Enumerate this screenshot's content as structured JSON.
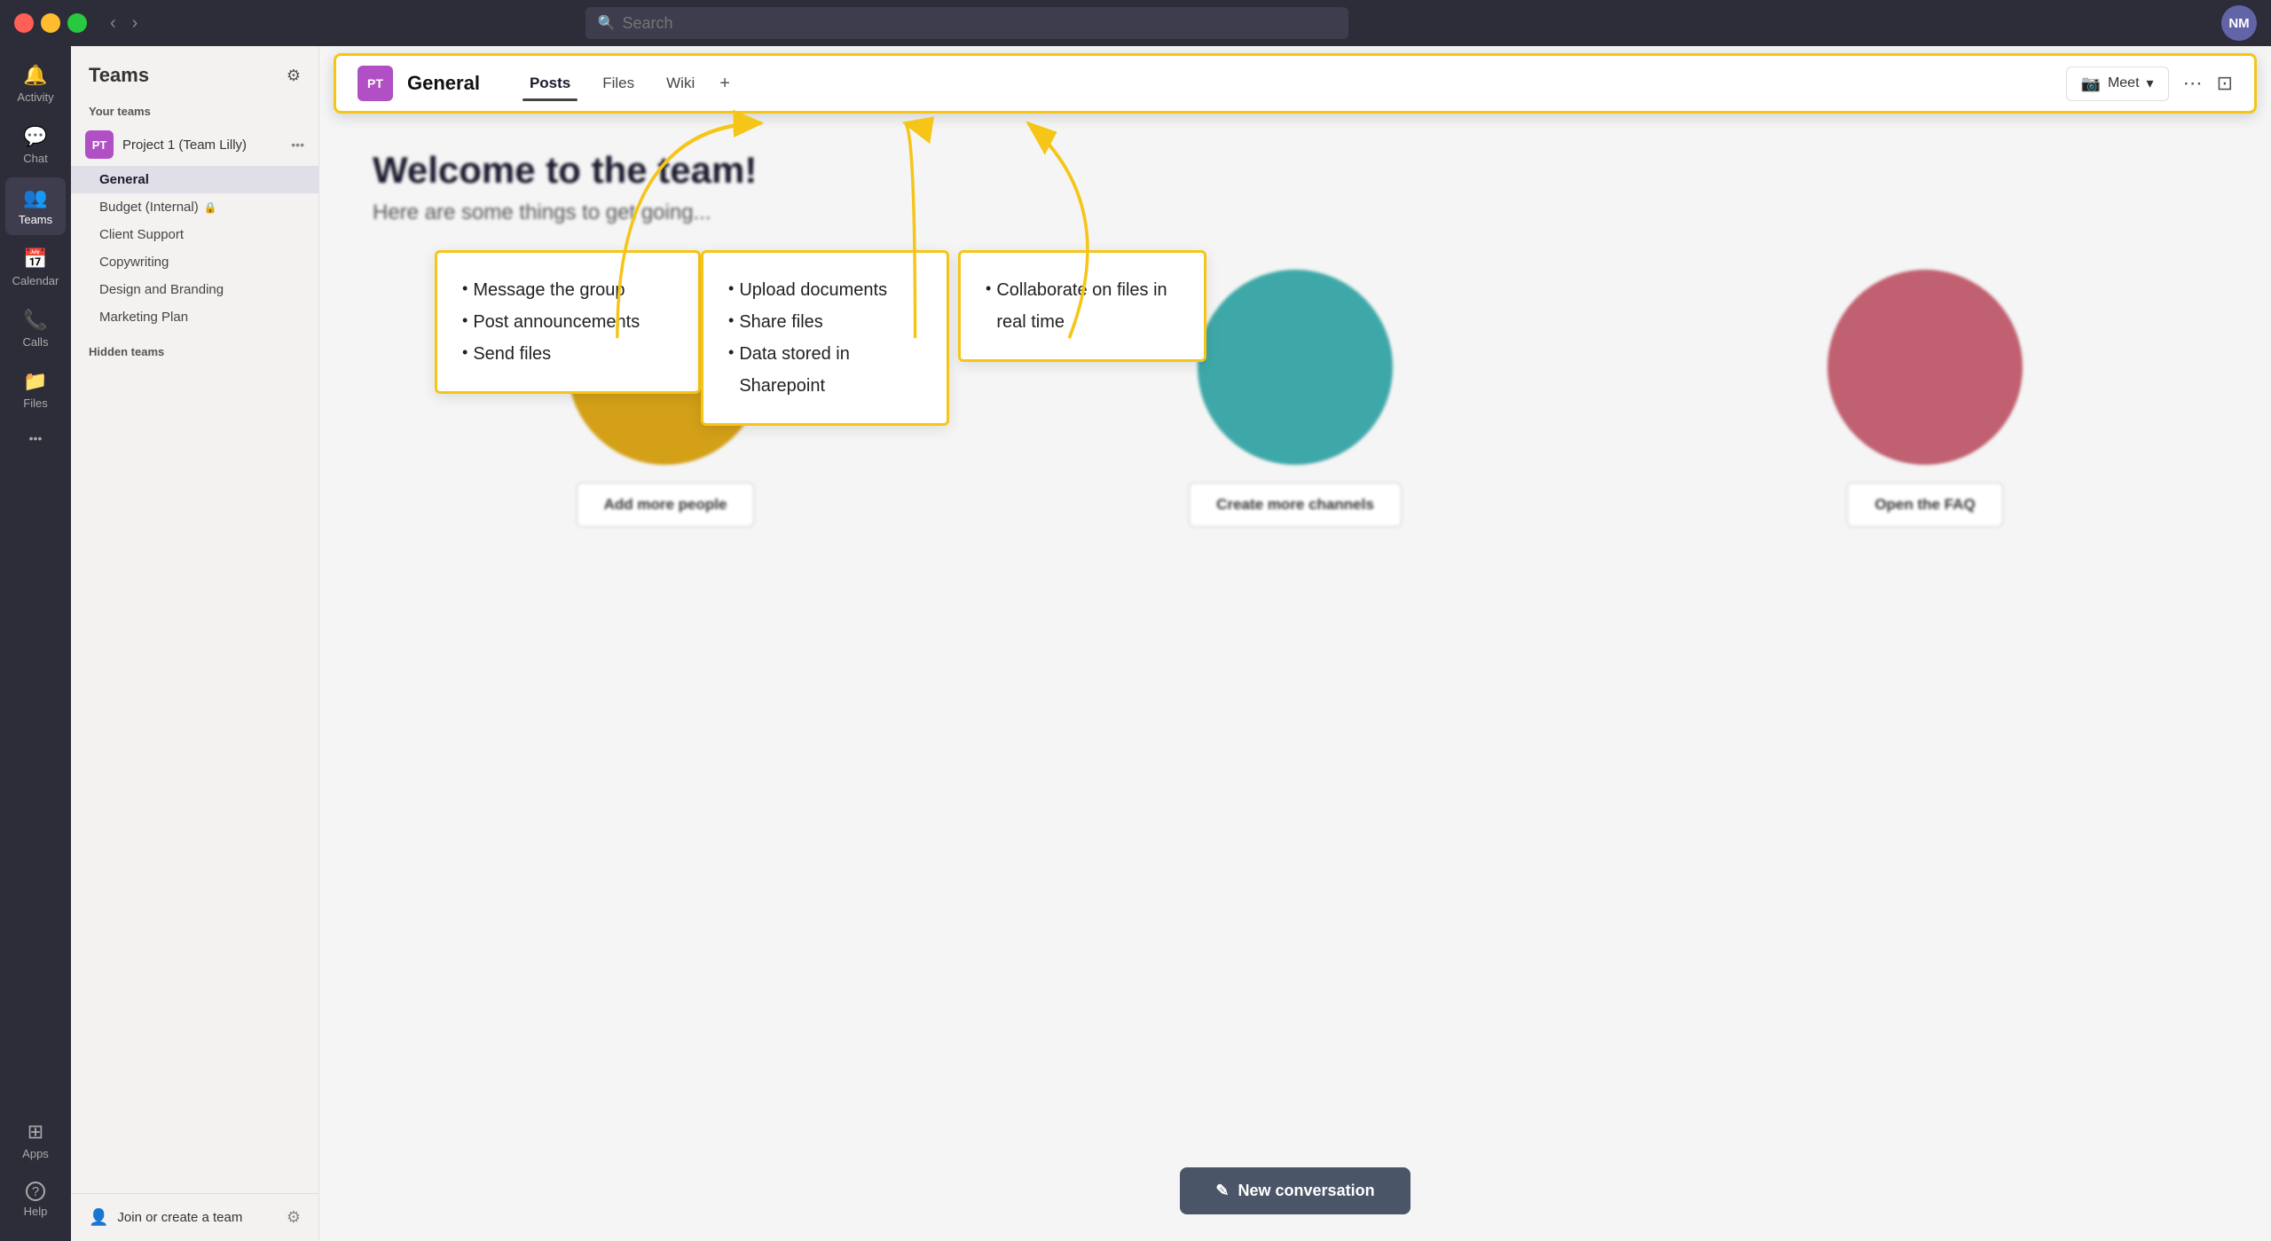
{
  "titlebar": {
    "search_placeholder": "Search"
  },
  "sidebar": {
    "items": [
      {
        "id": "activity",
        "label": "Activity",
        "icon": "🔔"
      },
      {
        "id": "chat",
        "label": "Chat",
        "icon": "💬"
      },
      {
        "id": "teams",
        "label": "Teams",
        "icon": "👥",
        "active": true
      },
      {
        "id": "calendar",
        "label": "Calendar",
        "icon": "📅"
      },
      {
        "id": "calls",
        "label": "Calls",
        "icon": "📞"
      },
      {
        "id": "files",
        "label": "Files",
        "icon": "📁"
      }
    ],
    "bottom_items": [
      {
        "id": "apps",
        "label": "Apps",
        "icon": "⊞"
      },
      {
        "id": "help",
        "label": "Help",
        "icon": "?"
      }
    ]
  },
  "teams_panel": {
    "title": "Teams",
    "your_teams_label": "Your teams",
    "team": {
      "name": "Project 1 (Team Lilly)",
      "badge": "PT"
    },
    "channels": [
      {
        "name": "General",
        "active": true
      },
      {
        "name": "Budget (Internal)",
        "lock": true
      },
      {
        "name": "Client Support"
      },
      {
        "name": "Copywriting"
      },
      {
        "name": "Design and Branding"
      },
      {
        "name": "Marketing Plan"
      }
    ],
    "hidden_teams_label": "Hidden teams",
    "join_label": "Join or create a team"
  },
  "channel_header": {
    "badge": "PT",
    "name": "General",
    "tabs": [
      {
        "label": "Posts",
        "active": true
      },
      {
        "label": "Files"
      },
      {
        "label": "Wiki"
      }
    ],
    "plus_icon": "+",
    "meet_label": "Meet",
    "meet_dropdown": "▾"
  },
  "welcome": {
    "title": "Welcome to the team!",
    "subtitle": "Here are some things to get going...",
    "cards": [
      {
        "circle_color": "#d4a017",
        "button_label": "Add more people"
      },
      {
        "circle_color": "#3ea8a8",
        "button_label": "Create more channels"
      },
      {
        "circle_color": "#c06070",
        "button_label": "Open the FAQ"
      }
    ]
  },
  "new_conversation": {
    "label": "New conversation",
    "icon": "✎"
  },
  "callouts": {
    "posts": {
      "items": [
        "Message the group",
        "Post announcements",
        "Send files"
      ]
    },
    "files": {
      "items": [
        "Upload documents",
        "Share files",
        "Data stored in Sharepoint"
      ]
    },
    "wiki": {
      "items": [
        "Collaborate on files in real time"
      ]
    }
  },
  "user_avatar": "NM",
  "colors": {
    "arrow": "#f5c518",
    "callout_border": "#f5c518"
  }
}
